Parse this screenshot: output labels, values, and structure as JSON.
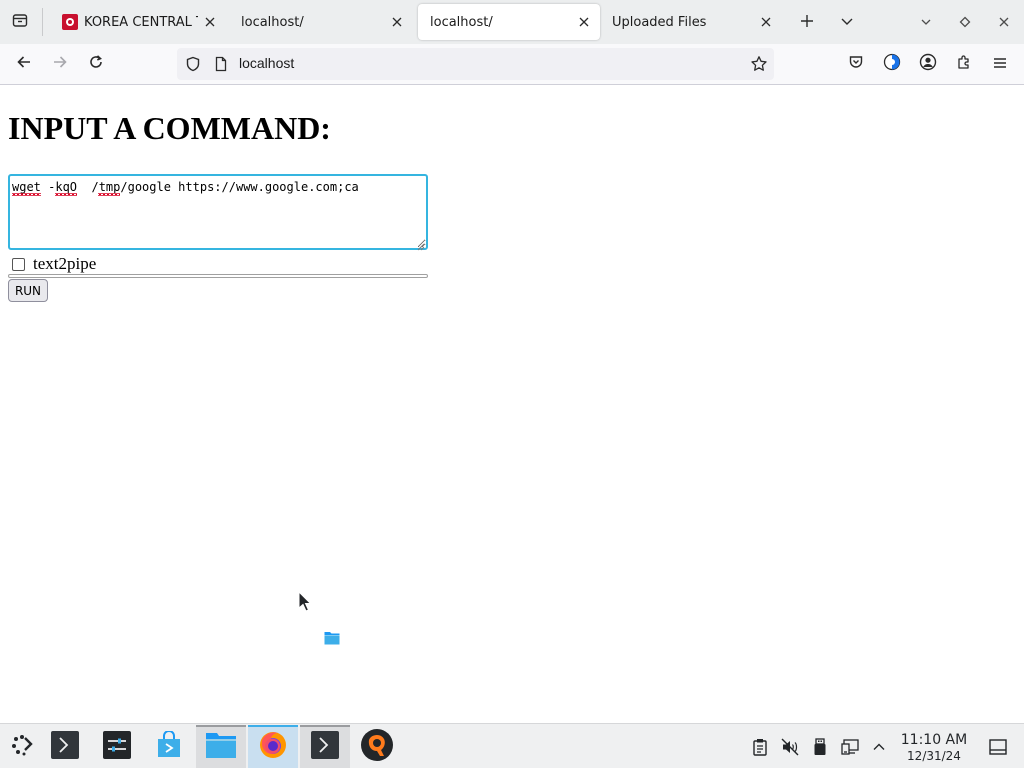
{
  "browser": {
    "tabs": [
      {
        "title": "KOREA CENTRAL TV",
        "active": false,
        "has_favicon": true
      },
      {
        "title": "localhost/",
        "active": false,
        "has_favicon": false
      },
      {
        "title": "localhost/",
        "active": true,
        "has_favicon": false
      },
      {
        "title": "Uploaded Files",
        "active": false,
        "has_favicon": false
      }
    ],
    "url": "localhost",
    "accent_color": "#35b5e0"
  },
  "page": {
    "heading": "INPUT A COMMAND:",
    "command_value": "wget -kqO  /tmp/google https://www.google.com;ca",
    "checkbox_label": "text2pipe",
    "checkbox_checked": false,
    "run_button_label": "RUN"
  },
  "taskbar": {
    "apps": [
      {
        "name": "application-launcher-icon"
      },
      {
        "name": "konsole-icon"
      },
      {
        "name": "system-settings-icon"
      },
      {
        "name": "discover-store-icon"
      },
      {
        "name": "dolphin-files-icon",
        "state": "running"
      },
      {
        "name": "firefox-icon",
        "state": "active"
      },
      {
        "name": "terminal-icon",
        "state": "running"
      },
      {
        "name": "qbittorrent-icon"
      }
    ],
    "clock": {
      "time": "11:10 AM",
      "date": "12/31/24"
    }
  }
}
